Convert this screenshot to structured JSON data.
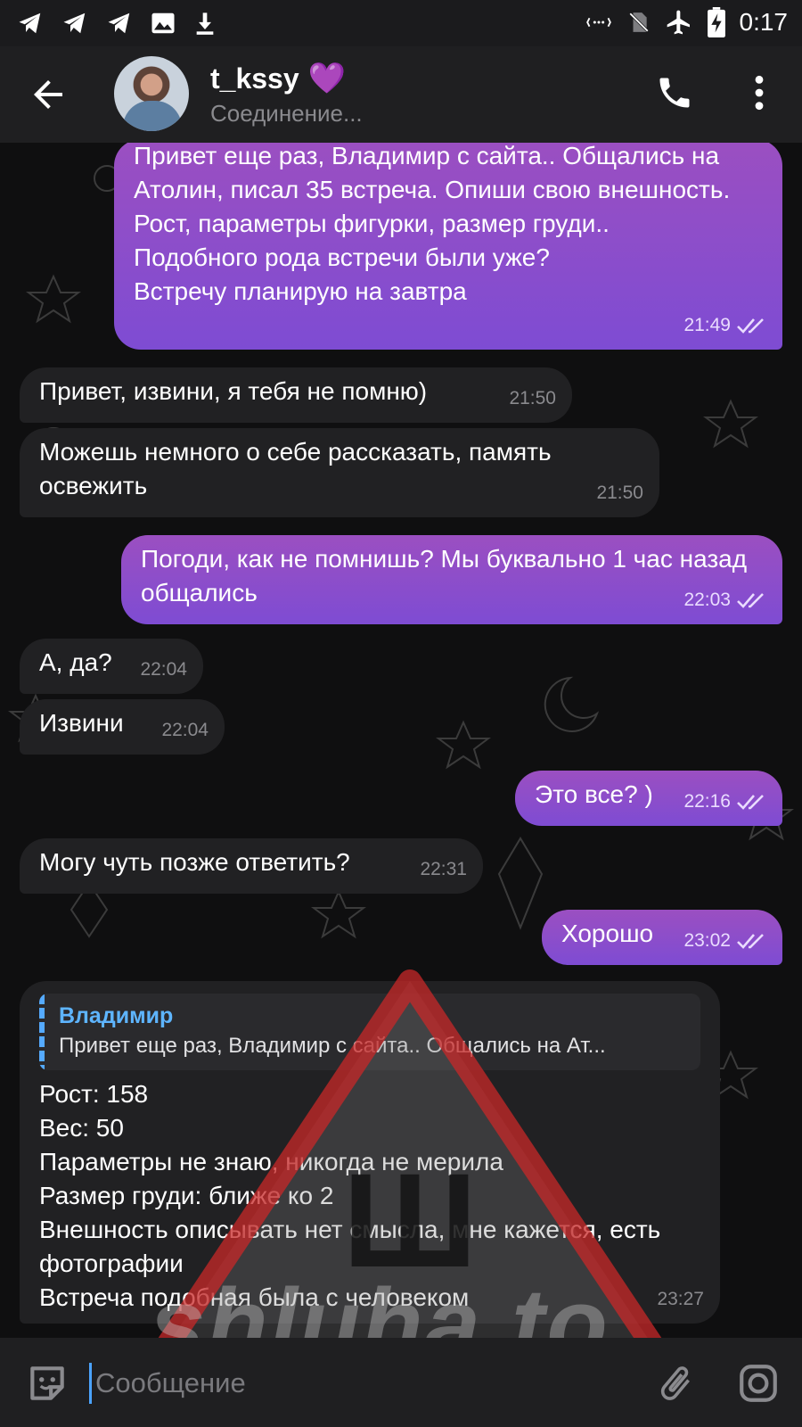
{
  "status_bar": {
    "time": "0:17",
    "left_icons": [
      "telegram-icon",
      "telegram-icon",
      "telegram-icon",
      "image-icon",
      "download-icon"
    ],
    "right_icons": [
      "vibrate-icon",
      "no-sim-icon",
      "airplane-icon",
      "battery-charging-icon"
    ]
  },
  "header": {
    "title": "t_kssy",
    "title_emoji": "💜",
    "status": "Соединение...",
    "icons": [
      "back-arrow-icon",
      "phone-icon",
      "more-vert-icon"
    ]
  },
  "messages": [
    {
      "direction": "out",
      "text": "Привет еще раз, Владимир с сайта.. Общались на Атолин, писал 35 встреча. Опиши свою внешность. Рост, параметры фигурки, размер груди..\nПодобного рода встречи были уже?\nВстречу планирую на завтра",
      "time": "21:49",
      "read": true
    },
    {
      "direction": "in",
      "text": "Привет, извини, я тебя не помню)",
      "time": "21:50"
    },
    {
      "direction": "in",
      "text": "Можешь немного о себе рассказать, память освежить",
      "time": "21:50"
    },
    {
      "direction": "out",
      "text": "Погоди, как не помнишь? Мы буквально 1 час назад общались",
      "time": "22:03",
      "read": true
    },
    {
      "direction": "in",
      "text": "А, да?",
      "time": "22:04"
    },
    {
      "direction": "in",
      "text": "Извини",
      "time": "22:04"
    },
    {
      "direction": "out",
      "text": "Это все? )",
      "time": "22:16",
      "read": true
    },
    {
      "direction": "in",
      "text": "Могу чуть позже ответить?",
      "time": "22:31"
    },
    {
      "direction": "out",
      "text": "Хорошо",
      "time": "23:02",
      "read": true
    },
    {
      "direction": "in",
      "reply": {
        "name": "Владимир",
        "text": "Привет еще раз, Владимир с сайта.. Общались на Ат..."
      },
      "text": "Рост: 158\nВес: 50\nПараметры не знаю, никогда не мерила\nРазмер груди: ближе ко 2\nВнешность описывать нет смысла, мне кажется, есть фотографии\nВстреча подобная была с человеком",
      "time": "23:27"
    }
  ],
  "watermark": {
    "symbol": "Ш",
    "text": "shluha.to"
  },
  "composer": {
    "placeholder": "Сообщение",
    "icons": [
      "sticker-icon",
      "paperclip-icon",
      "camera-icon"
    ]
  },
  "colors": {
    "accent": "#4ba3ff",
    "outgoing_bubble": "#8a4ecb",
    "incoming_bubble": "#212123",
    "background": "#0f0f10"
  }
}
